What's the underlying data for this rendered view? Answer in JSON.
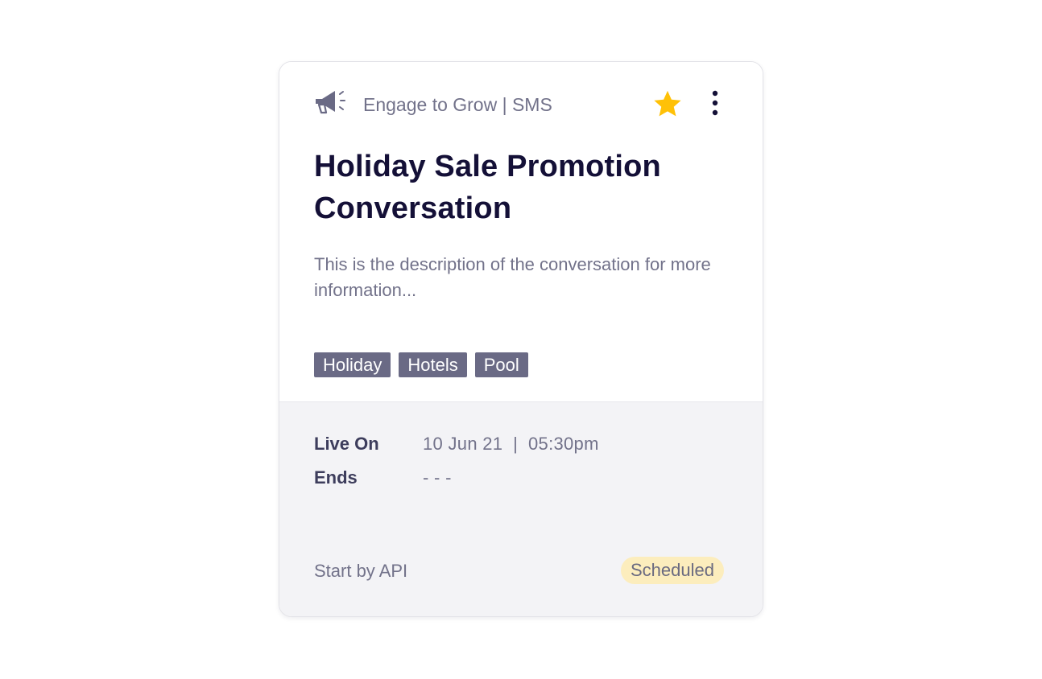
{
  "card": {
    "channel": "Engage to Grow | SMS",
    "title": "Holiday Sale Promotion Conversation",
    "description": "This is the description of the conversation for more information...",
    "tags": [
      "Holiday",
      "Hotels",
      "Pool"
    ],
    "schedule": {
      "live_on_label": "Live On",
      "live_on_value": "10 Jun 21  |  05:30pm",
      "ends_label": "Ends",
      "ends_value": "- - -"
    },
    "start_by": "Start by API",
    "status": "Scheduled",
    "icons": {
      "channel": "megaphone-icon",
      "favorite": "star-icon",
      "menu": "more-vertical-icon"
    },
    "colors": {
      "star": "#ffc107",
      "status_badge_bg": "#fcedbd",
      "tag_bg": "#6a6a85",
      "title": "#141037"
    }
  }
}
